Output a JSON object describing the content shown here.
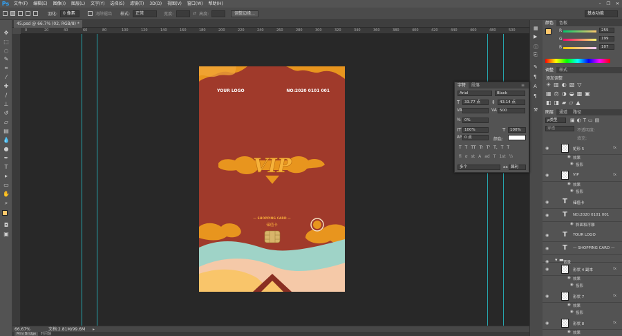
{
  "app": {
    "logo": "Ps"
  },
  "menu": [
    "文件(F)",
    "编辑(E)",
    "图像(I)",
    "图层(L)",
    "文字(Y)",
    "选择(S)",
    "滤镜(T)",
    "3D(D)",
    "视图(V)",
    "窗口(W)",
    "帮助(H)"
  ],
  "options": {
    "feather_label": "羽化:",
    "feather_value": "0 像素",
    "antialias_label": "消除锯齿",
    "style_label": "样式:",
    "style_value": "正常",
    "width_label": "宽度:",
    "height_label": "高度:",
    "refine_label": "调整边缘...",
    "workspace": "基本功能"
  },
  "document": {
    "tab": "45.psd @ 66.7% (02, RGB/8) *",
    "zoom": "66.67%",
    "doc_info": "文档:2.81M/99.6M"
  },
  "ruler_ticks": [
    "0",
    "20",
    "40",
    "60",
    "80",
    "100",
    "120",
    "140",
    "160",
    "180",
    "200",
    "220",
    "240",
    "260",
    "280",
    "300",
    "320",
    "340",
    "360",
    "380",
    "400",
    "420",
    "440",
    "460",
    "480",
    "500"
  ],
  "card": {
    "logo": "YOUR  LOGO",
    "number": "NO:2020 0101 001",
    "shopping": "— SHOPPING CARD —",
    "subtitle": "储值卡",
    "colors": {
      "bg": "#a03a2b",
      "orange": "#e8951e",
      "teal": "#9fd3c7",
      "peach": "#f5c9a8",
      "yellow": "#f9c56a"
    }
  },
  "bottom_tabs": [
    "Mini Bridge",
    "时间轴"
  ],
  "color_panel": {
    "tabs": [
      "颜色",
      "色板"
    ],
    "r": "255",
    "g": "199",
    "b": "107",
    "r_label": "R",
    "g_label": "G",
    "b_label": "B",
    "fg": "#ffc76b"
  },
  "adjust_panel": {
    "tabs": [
      "调整",
      "样式"
    ],
    "title": "添加调整"
  },
  "char_panel": {
    "tabs": [
      "字符",
      "段落"
    ],
    "font": "Arial",
    "weight": "Black",
    "size": "33.77 点",
    "leading": "43.14 点",
    "tracking": "500",
    "kerning": "0%",
    "vscale": "100%",
    "hscale": "100%",
    "baseline": "0 点",
    "color_label": "颜色:",
    "lang": "多个",
    "aa_label": "aa",
    "aa": "犀利",
    "styles": [
      "T",
      "T",
      "TT",
      "Tr",
      "T'",
      "T,",
      "T",
      "T"
    ],
    "styles2": [
      "fi",
      "σ",
      "st",
      "A",
      "ad",
      "T",
      "1st",
      "½"
    ]
  },
  "layers_panel": {
    "tabs": [
      "图层",
      "通道",
      "路径"
    ],
    "kind": "ρ类型",
    "mode": "穿透",
    "opacity_label": "不透明度:",
    "fill_label": "填充:"
  },
  "layers": [
    {
      "name": "矩形 5",
      "type": "shape",
      "fx": "fx"
    },
    {
      "name": "效果",
      "type": "sub"
    },
    {
      "name": "投影",
      "type": "sub2"
    },
    {
      "name": "VIP",
      "type": "shape",
      "fx": "fx"
    },
    {
      "name": "效果",
      "type": "sub"
    },
    {
      "name": "投影",
      "type": "sub2"
    },
    {
      "name": "储值卡",
      "type": "text"
    },
    {
      "name": "NO:2020 0101 001",
      "type": "text"
    },
    {
      "name": "斜面和浮雕",
      "type": "sub2"
    },
    {
      "name": "YOUR  LOGO",
      "type": "text"
    },
    {
      "name": "— SHOPPING CARD —",
      "type": "text"
    },
    {
      "name": "背景",
      "type": "group"
    },
    {
      "name": "形状 4 副本",
      "type": "shape",
      "fx": "fx"
    },
    {
      "name": "效果",
      "type": "sub"
    },
    {
      "name": "投影",
      "type": "sub2"
    },
    {
      "name": "形状 7",
      "type": "shape",
      "fx": "fx"
    },
    {
      "name": "效果",
      "type": "sub"
    },
    {
      "name": "投影",
      "type": "sub2"
    },
    {
      "name": "形状 8",
      "type": "shape",
      "fx": "fx"
    },
    {
      "name": "效果",
      "type": "sub"
    },
    {
      "name": "投影",
      "type": "sub2"
    }
  ]
}
